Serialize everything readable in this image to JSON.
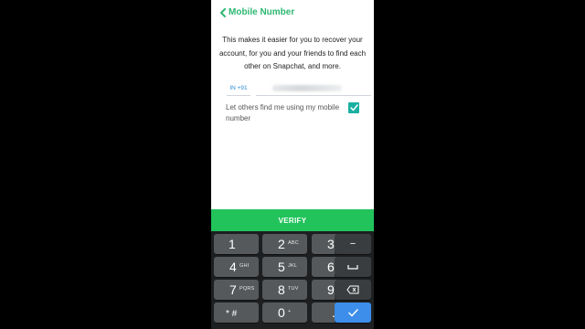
{
  "header": {
    "title": "Mobile Number"
  },
  "description": "This makes it easier for you to recover your account, for you and your friends to find each other on Snapchat, and more.",
  "phone": {
    "country_code": "IN +91"
  },
  "find_me": {
    "label": "Let others find me using my mobile number",
    "checked": true
  },
  "verify_label": "VERIFY",
  "keypad": {
    "rows": [
      [
        {
          "digit": "1",
          "letters": ""
        },
        {
          "digit": "2",
          "letters": "ABC"
        },
        {
          "digit": "3",
          "letters": "DEF"
        },
        {
          "symbol": "−",
          "name": "minus-key"
        }
      ],
      [
        {
          "digit": "4",
          "letters": "GHI"
        },
        {
          "digit": "5",
          "letters": "JKL"
        },
        {
          "digit": "6",
          "letters": "MNO"
        },
        {
          "symbol": "space-icon",
          "name": "space-key"
        }
      ],
      [
        {
          "digit": "7",
          "letters": "PQRS"
        },
        {
          "digit": "8",
          "letters": "TUV"
        },
        {
          "digit": "9",
          "letters": "WXYZ"
        },
        {
          "symbol": "backspace-icon",
          "name": "backspace-key"
        }
      ],
      [
        {
          "digit": "* #",
          "letters": ""
        },
        {
          "digit": "0",
          "letters": "+"
        },
        {
          "digit": ".",
          "letters": ""
        },
        {
          "symbol": "check-icon",
          "name": "done-key"
        }
      ]
    ]
  },
  "colors": {
    "accent_green": "#2eb872",
    "verify_green": "#22c35b",
    "checkbox_teal": "#19b0a2",
    "keyboard_bg": "#1d1f21",
    "key_bg": "#56595b",
    "done_blue": "#3d8eea"
  }
}
